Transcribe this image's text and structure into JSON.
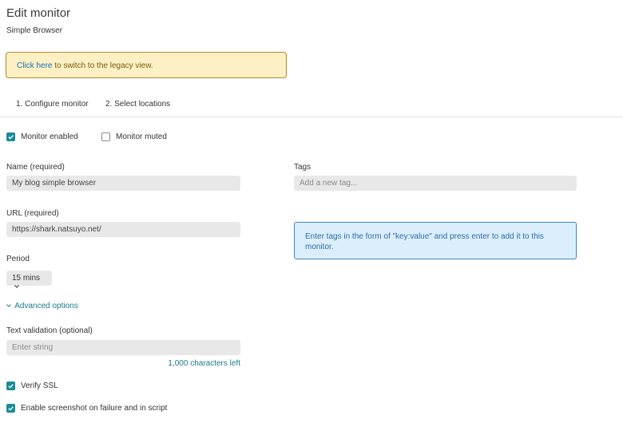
{
  "header": {
    "title": "Edit monitor",
    "subtitle": "Simple Browser"
  },
  "notice": {
    "link": "Click here",
    "text": " to switch to the legacy view."
  },
  "tabs": [
    {
      "label": "1. Configure monitor",
      "active": true
    },
    {
      "label": "2. Select locations",
      "active": false
    }
  ],
  "toggles": {
    "monitor_enabled": {
      "label": "Monitor enabled",
      "checked": true
    },
    "monitor_muted": {
      "label": "Monitor muted",
      "checked": false
    }
  },
  "form": {
    "name": {
      "label": "Name (required)",
      "value": "My blog simple browser"
    },
    "url": {
      "label": "URL (required)",
      "value": "https://shark.natsuyo.net/"
    },
    "period": {
      "label": "Period",
      "value": "15 mins"
    },
    "advanced": {
      "label": "Advanced options"
    },
    "text_validation": {
      "label": "Text validation (optional)",
      "placeholder": "Enter string",
      "counter": "1,000 characters left"
    },
    "verify_ssl": {
      "label": "Verify SSL",
      "checked": true
    },
    "screenshot": {
      "label": "Enable screenshot on failure and in script",
      "checked": true
    },
    "tags": {
      "label": "Tags",
      "placeholder": "Add a new tag..."
    },
    "tags_info": "Enter tags in the form of \"key:value\" and press enter to add it to this monitor."
  },
  "colors": {
    "accent": "#1b8c96",
    "link": "#1a6fb5",
    "notice_bg": "#fcf0c4",
    "info_bg": "#dceefc"
  }
}
